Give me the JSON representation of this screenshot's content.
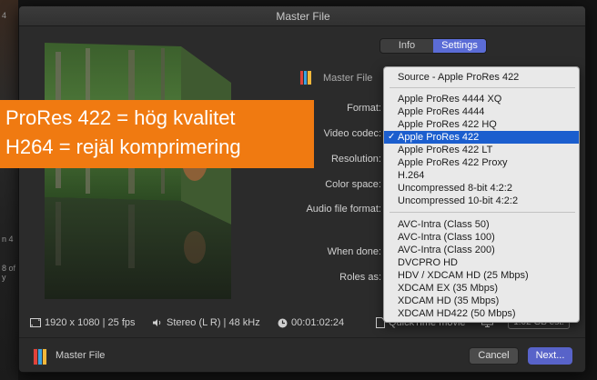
{
  "window": {
    "title": "Master File"
  },
  "tabs": [
    {
      "label": "Info",
      "active": false
    },
    {
      "label": "Settings",
      "active": true
    }
  ],
  "header": {
    "label": "Master File"
  },
  "form_labels": {
    "format": "Format:",
    "video_codec": "Video codec:",
    "resolution": "Resolution:",
    "color_space": "Color space:",
    "audio_file_format": "Audio file format:",
    "when_done": "When done:",
    "roles_as": "Roles as:"
  },
  "codec_menu": {
    "items": [
      {
        "label": "Source - Apple ProRes 422",
        "selected": false
      },
      {
        "label": "Apple ProRes 4444 XQ",
        "selected": false
      },
      {
        "label": "Apple ProRes 4444",
        "selected": false
      },
      {
        "label": "Apple ProRes 422 HQ",
        "selected": false
      },
      {
        "label": "Apple ProRes 422",
        "selected": true
      },
      {
        "label": "Apple ProRes 422 LT",
        "selected": false
      },
      {
        "label": "Apple ProRes 422 Proxy",
        "selected": false
      },
      {
        "label": "H.264",
        "selected": false
      },
      {
        "label": "Uncompressed 8-bit 4:2:2",
        "selected": false
      },
      {
        "label": "Uncompressed 10-bit 4:2:2",
        "selected": false
      },
      {
        "label": "AVC-Intra (Class 50)",
        "selected": false
      },
      {
        "label": "AVC-Intra (Class 100)",
        "selected": false
      },
      {
        "label": "AVC-Intra (Class 200)",
        "selected": false
      },
      {
        "label": "DVCPRO HD",
        "selected": false
      },
      {
        "label": "HDV / XDCAM HD (25 Mbps)",
        "selected": false
      },
      {
        "label": "XDCAM EX (35 Mbps)",
        "selected": false
      },
      {
        "label": "XDCAM HD (35 Mbps)",
        "selected": false
      },
      {
        "label": "XDCAM HD422 (50 Mbps)",
        "selected": false
      }
    ],
    "check_glyph": "✓",
    "selected_color": "#1b5ece"
  },
  "overlay": {
    "line1": "ProRes 422 = hög kvalitet",
    "line2": "H264 = rejäl komprimering",
    "color": "#f07a11"
  },
  "info_bar": {
    "resolution": "1920 x 1080 | 25 fps",
    "audio": "Stereo (L R) | 48 kHz",
    "duration": "00:01:02:24",
    "format": "QuickTime movie",
    "size": "1.02 GB est."
  },
  "footer": {
    "label": "Master File",
    "cancel": "Cancel",
    "next": "Next..."
  },
  "background_fragments": [
    "4",
    "n 4",
    "8 of",
    "y"
  ],
  "icons": [
    "master-file-icon",
    "frame-size-icon",
    "speaker-icon",
    "clock-icon",
    "document-icon",
    "monitor-icon",
    "checkmark-icon"
  ],
  "colors": {
    "accent": "#5b6cd6",
    "next_button": "#5863c9",
    "overlay": "#f07a11"
  }
}
